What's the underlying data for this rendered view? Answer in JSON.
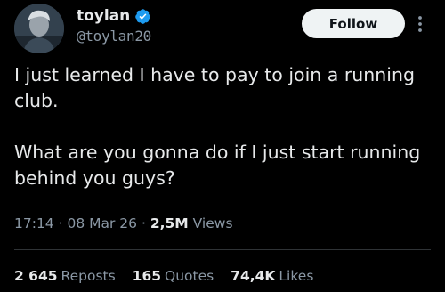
{
  "author": {
    "display_name": "toylan",
    "handle": "@toylan20",
    "avatar_icon": "avatar",
    "verified_icon": "verified-badge-icon"
  },
  "actions": {
    "follow_label": "Follow",
    "more_icon": "more-vertical-icon"
  },
  "tweet": {
    "paragraphs": [
      "I just learned I have to pay to join a running club.",
      "What are you gonna do if I just start running behind you guys?"
    ],
    "time": "17:14",
    "separator": "·",
    "date": "08 Mar 26",
    "views_count": "2,5M",
    "views_label": "Views"
  },
  "stats": {
    "reposts_count": "2 645",
    "reposts_label": "Reposts",
    "quotes_count": "165",
    "quotes_label": "Quotes",
    "likes_count": "74,4K",
    "likes_label": "Likes"
  },
  "colors": {
    "background": "#000000",
    "text": "#e7e9ea",
    "secondary": "#8b98a5",
    "verified": "#1d9bf0",
    "button_bg": "#eff3f4"
  }
}
